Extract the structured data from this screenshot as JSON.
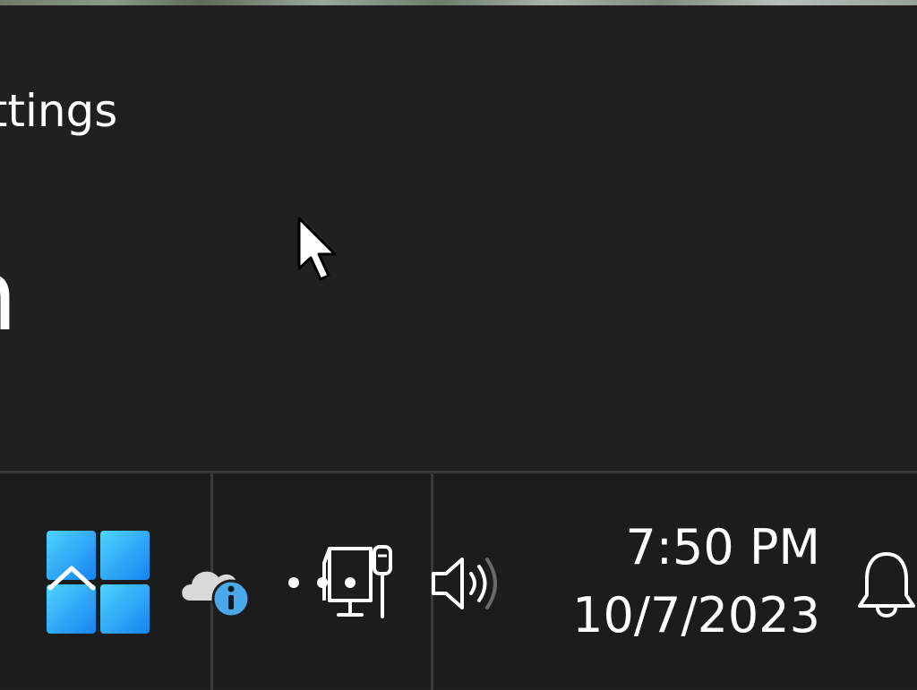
{
  "window": {
    "title": "Settings",
    "title_visible": "ettings",
    "heading_visible": "n"
  },
  "taskbar": {
    "start_label": "Start",
    "tray": {
      "show_hidden_icons_icon": "chevron-up-icon",
      "onedrive_icon": "onedrive-info-icon",
      "network_icon": "wired-network-icon",
      "volume_icon": "volume-icon"
    },
    "clock": {
      "time": "7:50 PM",
      "date": "10/7/2023"
    },
    "notifications_icon": "bell-icon"
  },
  "colors": {
    "window_bg": "#202020",
    "taskbar_bg": "#1c1c1c",
    "divider": "#3a3a3a",
    "accent_blue": "#1a9bf0",
    "info_badge": "#4aa8e8",
    "text": "#ffffff"
  }
}
